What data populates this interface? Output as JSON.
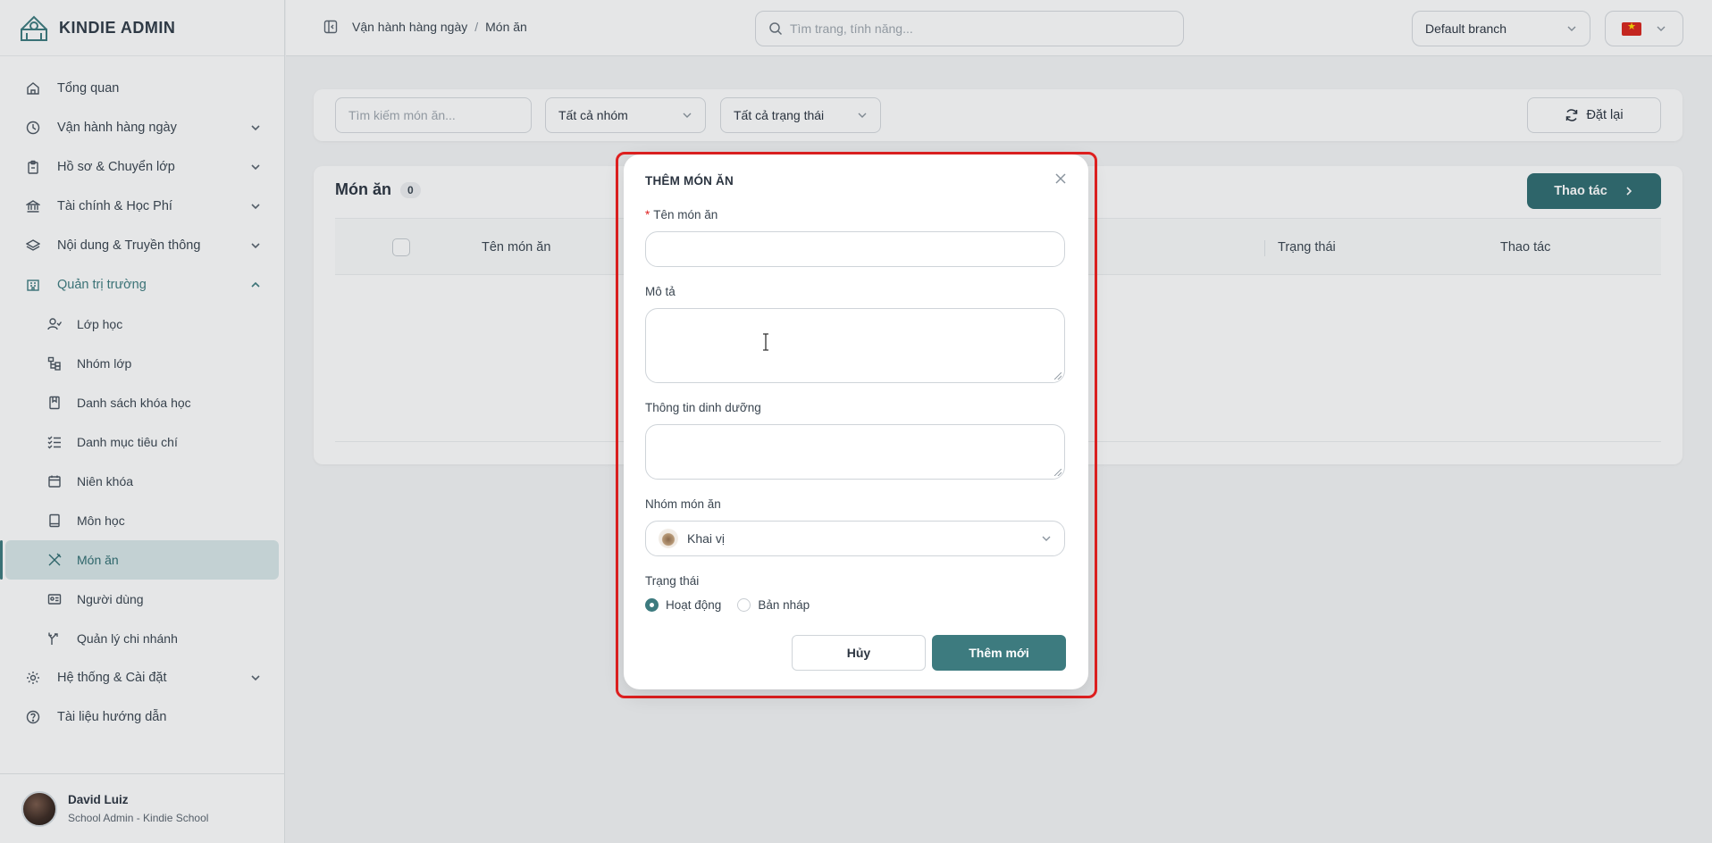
{
  "brand": {
    "name": "KINDIE ADMIN"
  },
  "sidebar": {
    "items": [
      {
        "label": "Tổng quan",
        "icon": "home-icon"
      },
      {
        "label": "Vận hành hàng ngày",
        "icon": "clock-icon"
      },
      {
        "label": "Hồ sơ & Chuyển lớp",
        "icon": "clipboard-icon"
      },
      {
        "label": "Tài chính & Học Phí",
        "icon": "bank-icon"
      },
      {
        "label": "Nội dung & Truyền thông",
        "icon": "layers-icon"
      },
      {
        "label": "Quản trị trường",
        "icon": "building-icon"
      }
    ],
    "sub_items": [
      {
        "label": "Lớp học",
        "icon": "user-check-icon"
      },
      {
        "label": "Nhóm lớp",
        "icon": "tree-icon"
      },
      {
        "label": "Danh sách khóa học",
        "icon": "bookmark-icon"
      },
      {
        "label": "Danh mục tiêu chí",
        "icon": "checklist-icon"
      },
      {
        "label": "Niên khóa",
        "icon": "calendar-icon"
      },
      {
        "label": "Môn học",
        "icon": "book-icon"
      },
      {
        "label": "Món ăn",
        "icon": "utensils-icon"
      },
      {
        "label": "Người dùng",
        "icon": "id-card-icon"
      },
      {
        "label": "Quản lý chi nhánh",
        "icon": "branch-icon"
      }
    ],
    "bottom_items": [
      {
        "label": "Hệ thống & Cài đặt",
        "icon": "gear-icon"
      },
      {
        "label": "Tài liệu hướng dẫn",
        "icon": "help-circle-icon"
      }
    ],
    "user": {
      "name": "David Luiz",
      "role": "School Admin - Kindie School"
    }
  },
  "topbar": {
    "breadcrumb": [
      "Vận hành hàng ngày",
      "Món ăn"
    ],
    "breadcrumb_sep": "/",
    "search_placeholder": "Tìm trang, tính năng...",
    "branch": "Default branch"
  },
  "filters": {
    "search_placeholder": "Tìm kiếm món ăn...",
    "group_select": "Tất cả nhóm",
    "status_select": "Tất cả trạng thái",
    "reset_label": "Đặt lại"
  },
  "table": {
    "title": "Món ăn",
    "count": "0",
    "action_label": "Thao tác",
    "columns": [
      "Tên món ăn",
      "Trạng thái",
      "Thao tác"
    ]
  },
  "modal": {
    "title": "THÊM MÓN ĂN",
    "name_label": "Tên món ăn",
    "required_mark": "*",
    "name_value": "",
    "desc_label": "Mô tả",
    "desc_value": "",
    "nutrition_label": "Thông tin dinh dưỡng",
    "nutrition_value": "",
    "group_label": "Nhóm món ăn",
    "group_value": "Khai vị",
    "status_label": "Trạng thái",
    "status_options": [
      "Hoạt động",
      "Bản nháp"
    ],
    "status_selected": "Hoạt động",
    "cancel_label": "Hủy",
    "submit_label": "Thêm mới"
  },
  "colors": {
    "accent": "#3d7b7f",
    "accent_dark": "#2f6d71",
    "highlight_border": "#e02020"
  }
}
